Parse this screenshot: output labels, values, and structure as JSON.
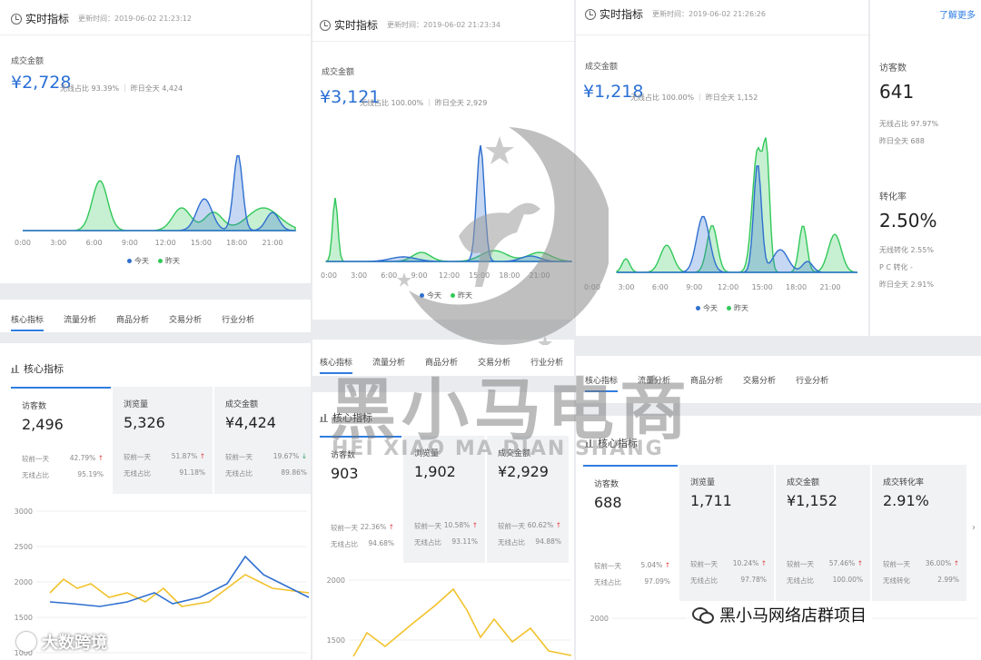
{
  "common": {
    "realtime_title": "实时指标",
    "gmv_label": "成交金额",
    "more_link": "了解更多",
    "legend_today": "今天",
    "legend_yesterday": "昨天",
    "x_ticks": [
      "0:00",
      "3:00",
      "6:00",
      "9:00",
      "12:00",
      "15:00",
      "18:00",
      "21:00"
    ],
    "tabs": [
      "核心指标",
      "流量分析",
      "商品分析",
      "交易分析",
      "行业分析"
    ],
    "core_title": "核心指标",
    "colors": {
      "today": "#2f6fd0",
      "yesterday": "#32c85a",
      "accent": "#2f7de1",
      "line_yellow": "#f2c22b"
    }
  },
  "shot1": {
    "update": "更新时间：2019-06-02 21:23:12",
    "amount": "¥2,728",
    "wireless": "无线占比 93.39%",
    "yesterday_full": "昨日全天 4,424",
    "cards": [
      {
        "label": "访客数",
        "value": "2,496",
        "r1k": "较前一天",
        "r1v": "42.79%",
        "r1d": "up",
        "r2k": "无线占比",
        "r2v": "95.19%"
      },
      {
        "label": "浏览量",
        "value": "5,326",
        "r1k": "较前一天",
        "r1v": "51.87%",
        "r1d": "up",
        "r2k": "无线占比",
        "r2v": "91.18%"
      },
      {
        "label": "成交金额",
        "value": "¥4,424",
        "r1k": "较前一天",
        "r1v": "19.67%",
        "r1d": "down",
        "r2k": "无线占比",
        "r2v": "89.86%"
      }
    ],
    "y_ticks": [
      "3000",
      "2500",
      "2000",
      "1500",
      "1000"
    ]
  },
  "shot2": {
    "update": "更新时间：2019-06-02 21:23:34",
    "amount": "¥3,121",
    "wireless": "无线占比 100.00%",
    "yesterday_full": "昨日全天 2,929",
    "cards": [
      {
        "label": "访客数",
        "value": "903",
        "r1k": "较前一天",
        "r1v": "22.36%",
        "r1d": "up",
        "r2k": "无线占比",
        "r2v": "94.68%"
      },
      {
        "label": "浏览量",
        "value": "1,902",
        "r1k": "较前一天",
        "r1v": "10.58%",
        "r1d": "up",
        "r2k": "无线占比",
        "r2v": "93.11%"
      },
      {
        "label": "成交金额",
        "value": "¥2,929",
        "r1k": "较前一天",
        "r1v": "60.62%",
        "r1d": "up",
        "r2k": "无线占比",
        "r2v": "94.88%"
      }
    ],
    "y_ticks": [
      "2000",
      "1500"
    ]
  },
  "shot3": {
    "update": "更新时间：2019-06-02 21:26:26",
    "amount": "¥1,218",
    "wireless": "无线占比 100.00%",
    "yesterday_full": "昨日全天 1,152",
    "visitors_label": "访客数",
    "visitors_value": "641",
    "visitors_wireless": "无线占比 97.97%",
    "visitors_yesterday": "昨日全天 688",
    "conv_label": "转化率",
    "conv_value": "2.50%",
    "conv_wireless": "无线转化 2.55%",
    "conv_pc": "P C 转化 -",
    "conv_yesterday": "昨日全天 2.91%",
    "cards": [
      {
        "label": "访客数",
        "value": "688",
        "r1k": "较前一天",
        "r1v": "5.04%",
        "r1d": "up",
        "r2k": "无线占比",
        "r2v": "97.09%"
      },
      {
        "label": "浏览量",
        "value": "1,711",
        "r1k": "较前一天",
        "r1v": "10.24%",
        "r1d": "up",
        "r2k": "无线占比",
        "r2v": "97.78%"
      },
      {
        "label": "成交金额",
        "value": "¥1,152",
        "r1k": "较前一天",
        "r1v": "57.46%",
        "r1d": "up",
        "r2k": "无线占比",
        "r2v": "100.00%"
      },
      {
        "label": "成交转化率",
        "value": "2.91%",
        "r1k": "较前一天",
        "r1v": "36.00%",
        "r1d": "up",
        "r2k": "无线转化",
        "r2v": "2.99%"
      }
    ],
    "y_ticks": [
      "2000"
    ]
  },
  "watermark": {
    "cn": "黑小马电商",
    "en": "HEI XIAO MA DIAN SHANG",
    "wechat": "黑小马网络店群项目",
    "corner": "大数跨境"
  }
}
